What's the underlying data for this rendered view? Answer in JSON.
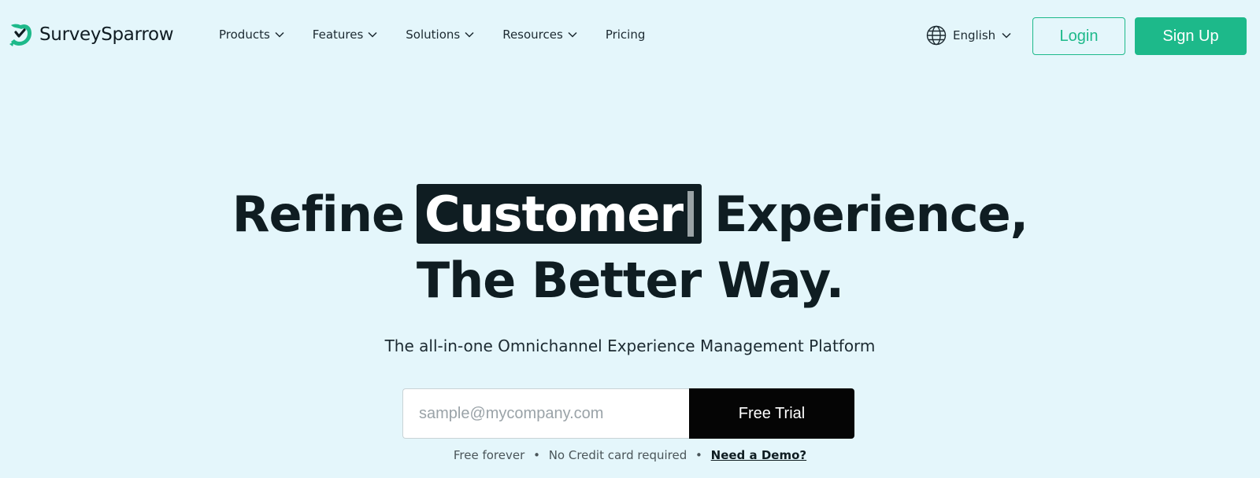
{
  "brand": {
    "name": "SurveySparrow",
    "accent_color": "#1db98a"
  },
  "nav": {
    "items": [
      {
        "label": "Products",
        "has_dropdown": true
      },
      {
        "label": "Features",
        "has_dropdown": true
      },
      {
        "label": "Solutions",
        "has_dropdown": true
      },
      {
        "label": "Resources",
        "has_dropdown": true
      },
      {
        "label": "Pricing",
        "has_dropdown": false
      }
    ]
  },
  "header": {
    "language": "English",
    "login_label": "Login",
    "signup_label": "Sign Up"
  },
  "hero": {
    "title_prefix": "Refine",
    "title_highlight": "Customer",
    "title_suffix": "Experience,",
    "title_line2": "The Better Way.",
    "subtitle": "The all-in-one Omnichannel Experience Management Platform",
    "email_placeholder": "sample@mycompany.com",
    "cta_label": "Free Trial",
    "footnote_1": "Free forever",
    "footnote_2": "No Credit card required",
    "demo_link": "Need a Demo?",
    "separator": "•"
  }
}
